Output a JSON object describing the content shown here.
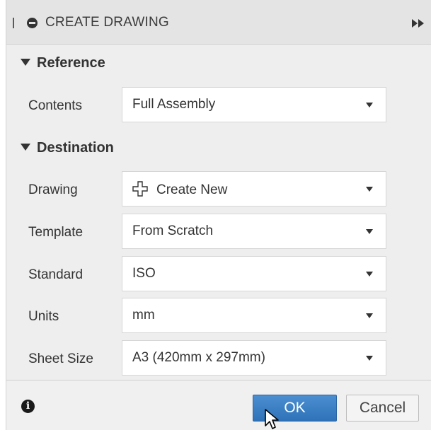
{
  "dialog": {
    "title": "CREATE DRAWING"
  },
  "sections": {
    "reference": {
      "header": "Reference",
      "contents_label": "Contents",
      "contents_value": "Full Assembly"
    },
    "destination": {
      "header": "Destination",
      "drawing_label": "Drawing",
      "drawing_value": "Create New",
      "template_label": "Template",
      "template_value": "From Scratch",
      "standard_label": "Standard",
      "standard_value": "ISO",
      "units_label": "Units",
      "units_value": "mm",
      "sheet_size_label": "Sheet Size",
      "sheet_size_value": "A3 (420mm x 297mm)"
    }
  },
  "footer": {
    "ok_label": "OK",
    "cancel_label": "Cancel"
  },
  "colors": {
    "ok_button": "#3a7fc4",
    "dialog_background": "#eeeeee",
    "titlebar": "#e4e4e4"
  },
  "icons": {
    "title": "minus-circle-icon",
    "expand": "double-chevron-right-icon",
    "drawing_new": "plus-outline-icon",
    "info": "info-icon",
    "pointer": "mouse-pointer-icon"
  }
}
